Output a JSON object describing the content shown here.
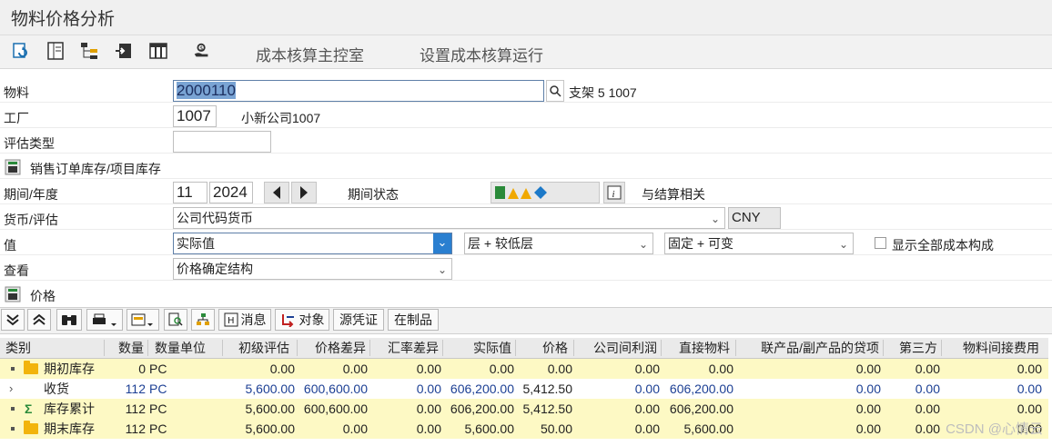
{
  "window": {
    "title": "物料价格分析"
  },
  "toolbar": {
    "icons": [
      "refresh-icon",
      "document-icon",
      "hierarchy-icon",
      "export-icon",
      "table-icon",
      "cost-hand-icon"
    ],
    "cockpit_label": "成本核算主控室",
    "setup_label": "设置成本核算运行"
  },
  "form": {
    "material": {
      "label": "物料",
      "value": "2000110",
      "description": "支架 5 1007"
    },
    "plant": {
      "label": "工厂",
      "value": "1007",
      "description": "小新公司1007"
    },
    "valuation_type": {
      "label": "评估类型",
      "value": ""
    },
    "sales_order_section": "销售订单库存/项目库存",
    "period_year": {
      "label": "期间/年度",
      "period": "11",
      "year": "2024"
    },
    "period_status": {
      "label": "期间状态",
      "note": "与结算相关"
    },
    "currency": {
      "label": "货币/评估",
      "value": "公司代码货币",
      "code": "CNY"
    },
    "value": {
      "label": "值",
      "value1": "实际值",
      "value2": "层 + 较低层",
      "value3": "固定 + 可变",
      "checkbox_label": "显示全部成本构成"
    },
    "view": {
      "label": "查看",
      "value": "价格确定结构"
    },
    "price_section": "价格"
  },
  "alv_toolbar": {
    "message_label": "消息",
    "object_label": "对象",
    "source_doc_label": "源凭证",
    "wip_label": "在制品"
  },
  "grid": {
    "headers": [
      "类别",
      "数量",
      "数量单位",
      "初级评估",
      "价格差异",
      "汇率差异",
      "实际值",
      "价格",
      "公司间利润",
      "直接物料",
      "联产品/副产品的贷项",
      "第三方",
      "物料间接费用"
    ],
    "rows": [
      {
        "icon": "folder-icon",
        "category": "期初库存",
        "qty": "0",
        "unit": "PC",
        "primary": "0.00",
        "price_var": "0.00",
        "fx_var": "0.00",
        "actual": "0.00",
        "price": "0.00",
        "ic_profit": "0.00",
        "direct_mat": "0.00",
        "coproduct": "0.00",
        "third_party": "0.00",
        "mat_overhead": "0.00"
      },
      {
        "icon": "chevron-right-icon",
        "category": "收货",
        "qty": "112",
        "unit": "PC",
        "primary": "5,600.00",
        "price_var": "600,600.00",
        "fx_var": "0.00",
        "actual": "606,200.00",
        "price": "5,412.50",
        "ic_profit": "0.00",
        "direct_mat": "606,200.00",
        "coproduct": "0.00",
        "third_party": "0.00",
        "mat_overhead": "0.00"
      },
      {
        "icon": "sigma-icon",
        "category": "库存累计",
        "qty": "112",
        "unit": "PC",
        "primary": "5,600.00",
        "price_var": "600,600.00",
        "fx_var": "0.00",
        "actual": "606,200.00",
        "price": "5,412.50",
        "ic_profit": "0.00",
        "direct_mat": "606,200.00",
        "coproduct": "0.00",
        "third_party": "0.00",
        "mat_overhead": "0.00"
      },
      {
        "icon": "folder-icon",
        "category": "期末库存",
        "qty": "112",
        "unit": "PC",
        "primary": "5,600.00",
        "price_var": "0.00",
        "fx_var": "0.00",
        "actual": "5,600.00",
        "price": "50.00",
        "ic_profit": "0.00",
        "direct_mat": "5,600.00",
        "coproduct": "0.00",
        "third_party": "0.00",
        "mat_overhead": "0.00"
      }
    ]
  },
  "watermark": "CSDN @心情云"
}
